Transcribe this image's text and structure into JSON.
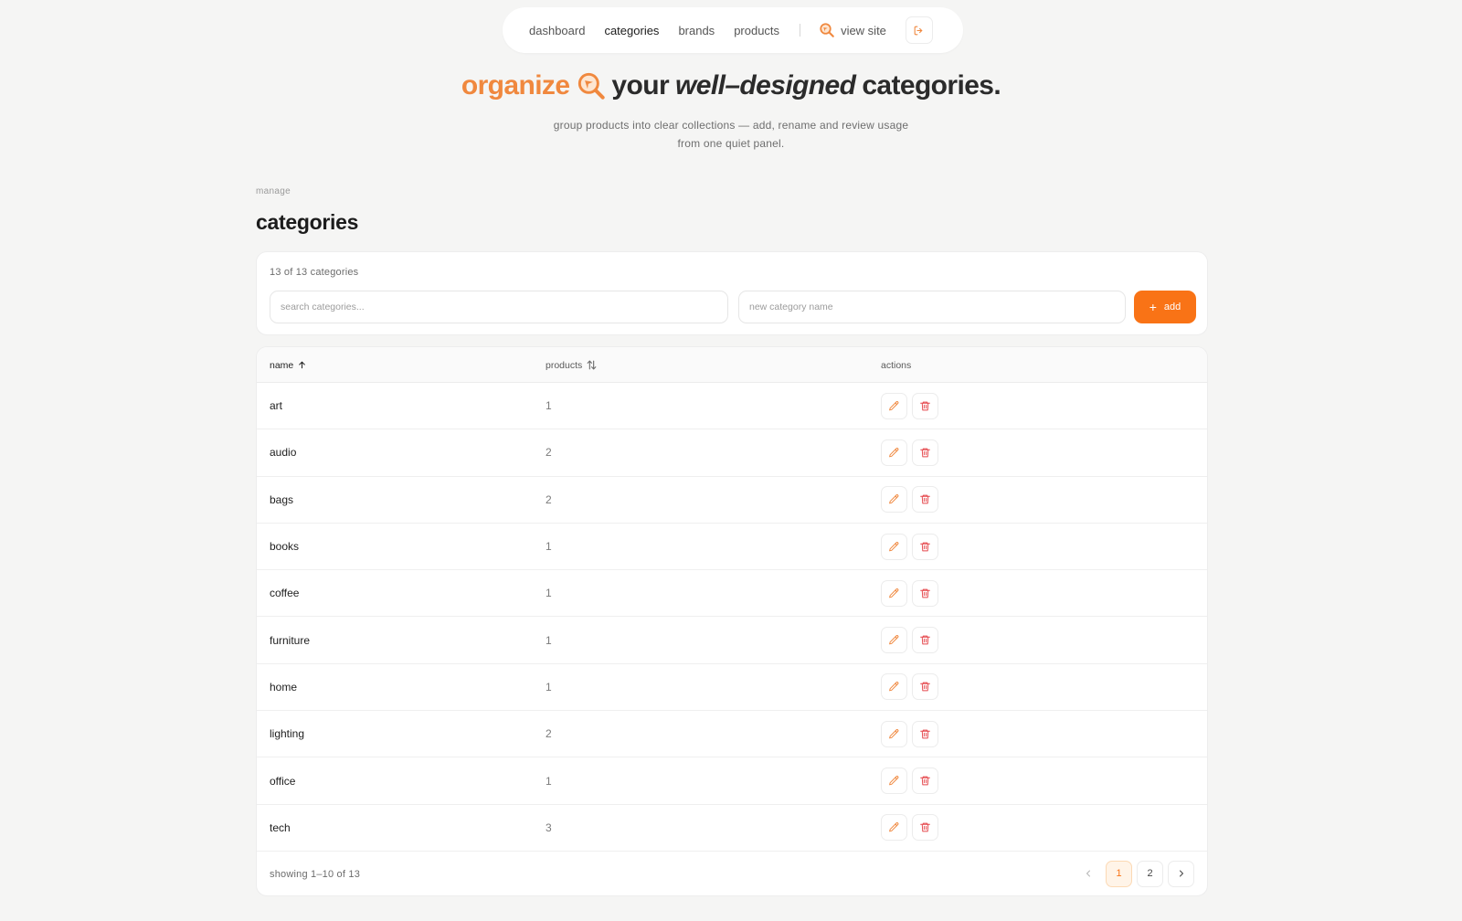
{
  "nav": {
    "links": [
      "dashboard",
      "categories",
      "brands",
      "products"
    ],
    "active": "categories",
    "view_site": "view site"
  },
  "hero": {
    "accent_word": "organize",
    "before_em": "your",
    "em_word": "well–designed",
    "after_em": "categories.",
    "subtitle_line1": "group products into clear collections — add, rename and review usage",
    "subtitle_line2": "from one quiet panel."
  },
  "section": {
    "eyebrow": "manage",
    "title": "categories"
  },
  "toolbar": {
    "count_label": "13 of 13 categories",
    "search_placeholder": "search categories...",
    "new_placeholder": "new category name",
    "add_label": "add"
  },
  "table": {
    "columns": {
      "name": "name",
      "products": "products",
      "actions": "actions"
    },
    "rows": [
      {
        "name": "art",
        "products": "1"
      },
      {
        "name": "audio",
        "products": "2"
      },
      {
        "name": "bags",
        "products": "2"
      },
      {
        "name": "books",
        "products": "1"
      },
      {
        "name": "coffee",
        "products": "1"
      },
      {
        "name": "furniture",
        "products": "1"
      },
      {
        "name": "home",
        "products": "1"
      },
      {
        "name": "lighting",
        "products": "2"
      },
      {
        "name": "office",
        "products": "1"
      },
      {
        "name": "tech",
        "products": "3"
      }
    ],
    "showing": "showing 1–10 of 13",
    "pages": [
      "1",
      "2"
    ],
    "current_page": "1"
  },
  "colors": {
    "accent": "#f97316",
    "accent_soft": "#f0883e",
    "delete": "#e5484d"
  },
  "icons": {
    "nav_brand": "magnifier-arrow-icon",
    "logout": "logout-icon",
    "sort_asc": "arrow-up-icon",
    "sort_both": "arrows-up-down-icon",
    "edit": "pencil-icon",
    "delete": "trash-icon",
    "prev": "chevron-left-icon",
    "next": "chevron-right-icon"
  }
}
